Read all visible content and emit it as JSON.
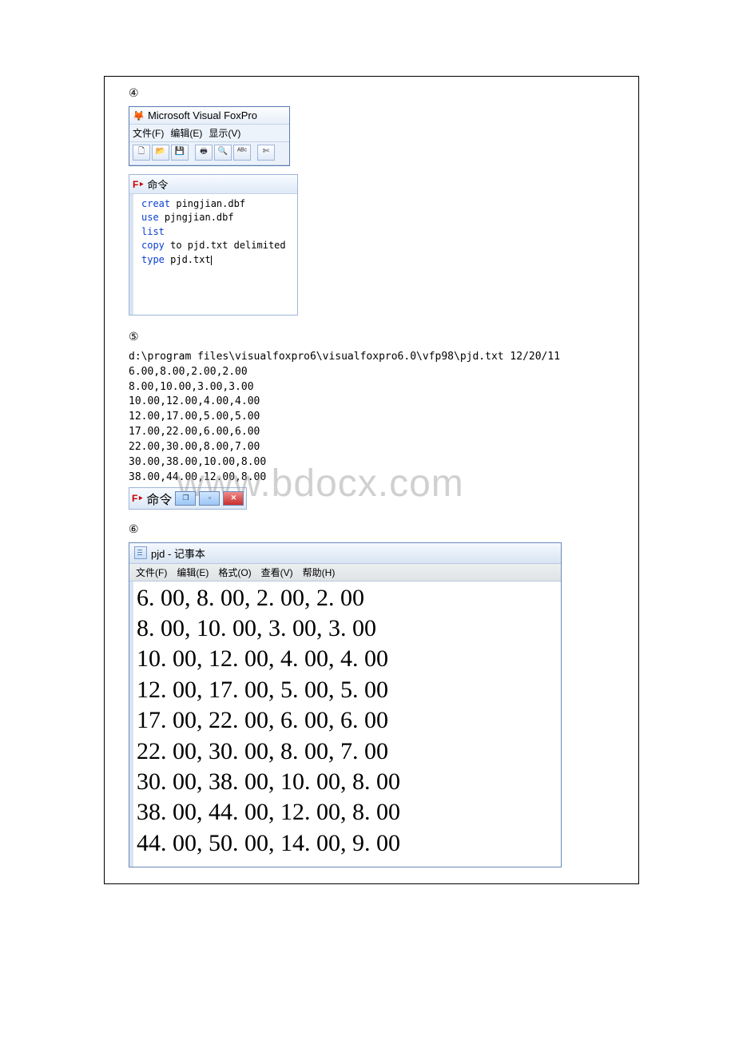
{
  "labels": {
    "four": "④",
    "five": "⑤",
    "six": "⑥"
  },
  "foxpro": {
    "title": "Microsoft Visual FoxPro",
    "menu": {
      "file": "文件(F)",
      "edit": "编辑(E)",
      "view": "显示(V)"
    },
    "toolbar": {
      "new": "🗋",
      "open": "📂",
      "save": "💾",
      "print": "🖶",
      "preview": "🔍",
      "spell": "ᴬᴮᶜ",
      "cut": "✄"
    },
    "cmd_label": "命令",
    "cmd_lines": [
      {
        "kw": "creat",
        "rest": " pingjian.dbf"
      },
      {
        "kw": "use",
        "rest": " pjngjian.dbf"
      },
      {
        "kw": "list",
        "rest": ""
      },
      {
        "kw": "copy",
        "rest": " to pjd.txt delimited"
      },
      {
        "kw": "type",
        "rest": " pjd.txt"
      }
    ]
  },
  "output": {
    "path_line": "d:\\program files\\visualfoxpro6\\visualfoxpro6.0\\vfp98\\pjd.txt 12/20/11",
    "rows": [
      "6.00,8.00,2.00,2.00",
      "8.00,10.00,3.00,3.00",
      "10.00,12.00,4.00,4.00",
      "12.00,17.00,5.00,5.00",
      "17.00,22.00,6.00,6.00",
      "22.00,30.00,8.00,7.00",
      "30.00,38.00,10.00,8.00",
      "38.00,44.00,12.00,8.00"
    ]
  },
  "minibar": {
    "label": "命令",
    "min": "❐",
    "max": "▫",
    "close": "✕"
  },
  "watermark": "www.bdocx.com",
  "notepad": {
    "title": "pjd - 记事本",
    "menu": {
      "file": "文件(F)",
      "edit": "编辑(E)",
      "format": "格式(O)",
      "view": "查看(V)",
      "help": "帮助(H)"
    },
    "lines": [
      "6. 00, 8. 00, 2. 00, 2. 00",
      "8. 00, 10. 00, 3. 00, 3. 00",
      "10. 00, 12. 00, 4. 00, 4. 00",
      "12. 00, 17. 00, 5. 00, 5. 00",
      "17. 00, 22. 00, 6. 00, 6. 00",
      "22. 00, 30. 00, 8. 00, 7. 00",
      "30. 00, 38. 00, 10. 00, 8. 00",
      "38. 00, 44. 00, 12. 00, 8. 00",
      "44. 00, 50. 00, 14. 00, 9. 00"
    ]
  }
}
